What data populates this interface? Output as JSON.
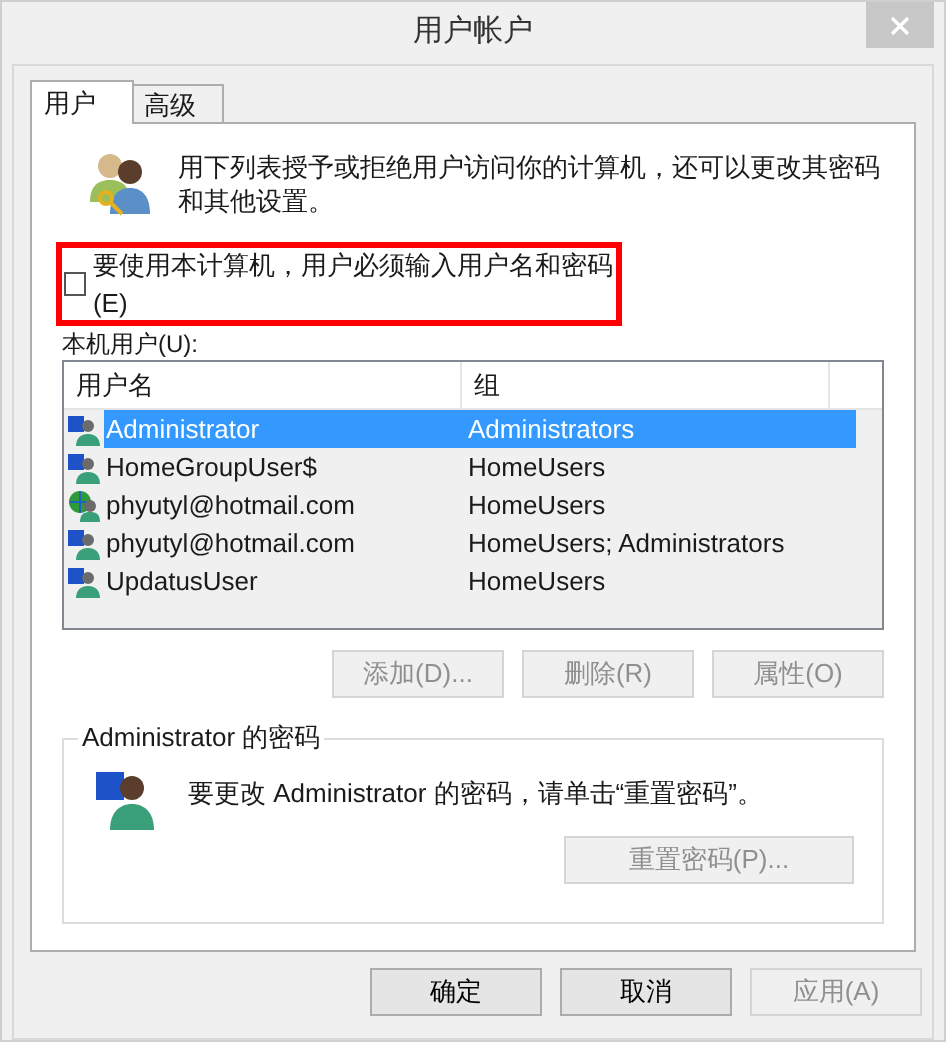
{
  "window": {
    "title": "用户帐户"
  },
  "tabs": [
    {
      "label": "用户",
      "selected": true
    },
    {
      "label": "高级",
      "selected": false
    }
  ],
  "description": "用下列表授予或拒绝用户访问你的计算机，还可以更改其密码和其他设置。",
  "require_password": {
    "label": "要使用本计算机，用户必须输入用户名和密码(E)",
    "checked": false
  },
  "users_label": "本机用户(U):",
  "table": {
    "columns": [
      "用户名",
      "组"
    ],
    "rows": [
      {
        "kind": "local",
        "name": "Administrator",
        "group": "Administrators",
        "selected": true
      },
      {
        "kind": "local",
        "name": "HomeGroupUser$",
        "group": "HomeUsers",
        "selected": false
      },
      {
        "kind": "online",
        "name": "phyutyl@hotmail.com",
        "group": "HomeUsers",
        "selected": false
      },
      {
        "kind": "local",
        "name": "phyutyl@hotmail.com",
        "group": "HomeUsers; Administrators",
        "selected": false
      },
      {
        "kind": "local",
        "name": "UpdatusUser",
        "group": "HomeUsers",
        "selected": false
      }
    ]
  },
  "user_buttons": [
    {
      "label": "添加(D)...",
      "disabled": true
    },
    {
      "label": "删除(R)",
      "disabled": true
    },
    {
      "label": "属性(O)",
      "disabled": true
    }
  ],
  "password_group": {
    "title": "Administrator 的密码",
    "text": "要更改 Administrator 的密码，请单击“重置密码”。",
    "reset_button": {
      "label": "重置密码(P)...",
      "disabled": true
    }
  },
  "dialog_buttons": [
    {
      "label": "确定",
      "disabled": false
    },
    {
      "label": "取消",
      "disabled": false
    },
    {
      "label": "应用(A)",
      "disabled": true
    }
  ]
}
